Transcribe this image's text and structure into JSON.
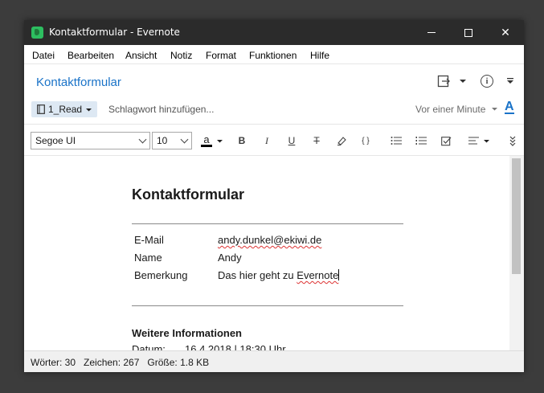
{
  "window": {
    "title": "Kontaktformular - Evernote",
    "app_icon": "evernote-elephant-icon",
    "close_glyph": "✕"
  },
  "menu": {
    "items": [
      "Datei",
      "Bearbeiten",
      "Ansicht",
      "Notiz",
      "Format",
      "Funktionen",
      "Hilfe"
    ]
  },
  "note_header": {
    "title": "Kontaktformular",
    "notebook": "1_Read",
    "tag_placeholder": "Schlagwort hinzufügen...",
    "modified": "Vor einer Minute",
    "info_glyph": "i",
    "font_color_glyph": "A"
  },
  "toolbar": {
    "font_family": "Segoe UI",
    "font_size": "10",
    "text_color_glyph": "a",
    "bold": "B",
    "italic": "I",
    "underline": "U",
    "strikethrough": "T",
    "code": "{ }"
  },
  "document": {
    "title": "Kontaktformular",
    "fields": [
      {
        "label": "E-Mail",
        "value": "andy.dunkel@ekiwi.de"
      },
      {
        "label": "Name",
        "value": "Andy"
      },
      {
        "label": "Bemerkung",
        "value_prefix": "Das hier geht zu ",
        "value_word": "Evernote"
      }
    ],
    "section_title": "Weitere Informationen",
    "datum_label": "Datum:",
    "datum_value": "16.4.2018 | 18:30 Uhr"
  },
  "status": {
    "text": "Wörter: 30   Zeichen: 267   Größe: 1.8 KB"
  },
  "colors": {
    "accent": "#1a73c8",
    "titlebar": "#2b2b2b",
    "evernote_green": "#2dbe60"
  }
}
